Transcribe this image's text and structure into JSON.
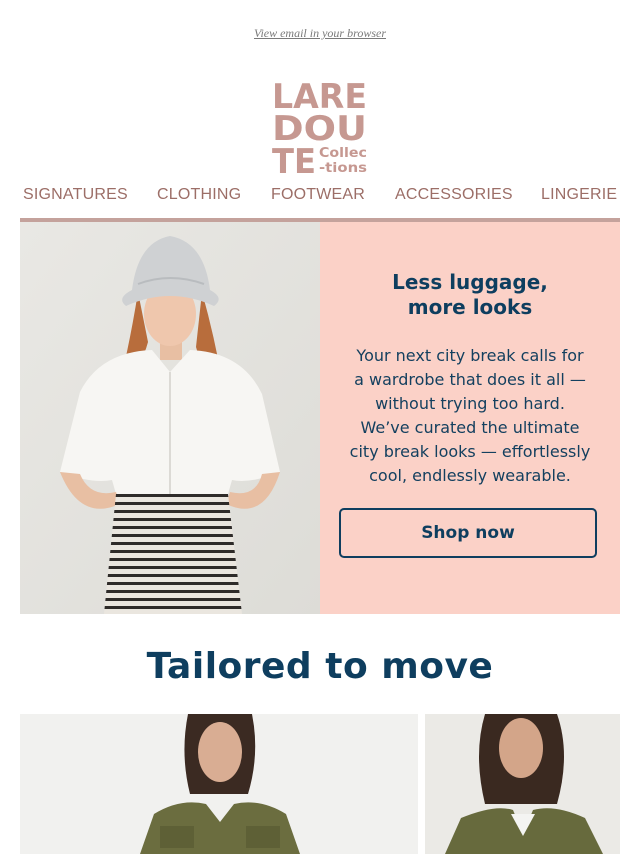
{
  "preheader": {
    "view_in_browser": "View email in your browser"
  },
  "brand": {
    "logo_lines": [
      "LARE",
      "DOU",
      "TE"
    ],
    "logo_suffix": [
      "Collec",
      "-tions"
    ],
    "logo_color": "#c69891"
  },
  "nav": {
    "items": [
      {
        "label": "SIGNATURES"
      },
      {
        "label": "CLOTHING"
      },
      {
        "label": "FOOTWEAR"
      },
      {
        "label": "ACCESSORIES"
      },
      {
        "label": "LINGERIE"
      }
    ],
    "color": "#9c6e67",
    "rule_color": "#c4a29c"
  },
  "hero": {
    "title_line1": "Less luggage,",
    "title_line2": "more looks",
    "body_lines": [
      "Your next city break calls for",
      "a wardrobe that does it all —",
      "without trying too hard.",
      "We’ve curated the ultimate",
      "city break looks — effortlessly",
      "cool, endlessly wearable."
    ],
    "cta": "Shop now",
    "panel_color": "#fbd1c7",
    "text_color": "#0e3e5f"
  },
  "section": {
    "title": "Tailored to move"
  }
}
